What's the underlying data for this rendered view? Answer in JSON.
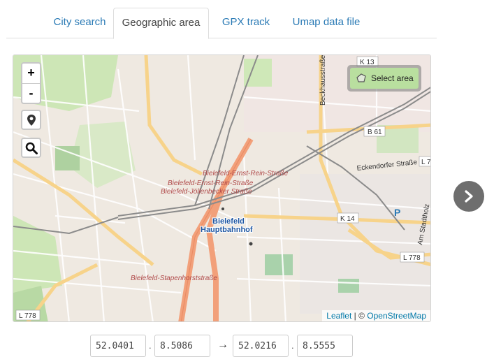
{
  "tabs": [
    {
      "label": "City search",
      "active": false
    },
    {
      "label": "Geographic area",
      "active": true
    },
    {
      "label": "GPX track",
      "active": false
    },
    {
      "label": "Umap data file",
      "active": false
    }
  ],
  "map": {
    "zoom_in_label": "+",
    "zoom_out_label": "-",
    "locate_icon": "map-marker-icon",
    "search_icon": "search-icon",
    "select_area_label": "Select area",
    "attribution": {
      "leaflet": "Leaflet",
      "separator": " | © ",
      "osm": "OpenStreetMap"
    },
    "labels": {
      "k13": "K 13",
      "beckhausstrasse": "Beckhausstraße",
      "b61": "B 61",
      "eckendorfer": "Eckendorfer Straße",
      "l7": "L 7",
      "k14": "K 14",
      "amstadtholz": "Am Stadtholz",
      "l778a": "L 778",
      "l778b": "L 778",
      "parking": "P",
      "station1": "Bielefeld-Ernst-Rein-Straße",
      "station2": "Bielefeld-Ernst-Rein-Straße",
      "station3": "Bielefeld-Jöllenbecker Straße",
      "hbf1": "Bielefeld",
      "hbf2": "Hauptbahnhof",
      "station4": "Bielefeld-Stapenhorststraße"
    },
    "colors": {
      "background": "#efe9e1",
      "railway": "#8a8a8a",
      "major_road": "#f3a77d",
      "secondary_road": "#fbd98e",
      "park": "#c8e3b0"
    }
  },
  "coordinates": {
    "lat1": "52.0401",
    "lon1": "8.5086",
    "lat2": "52.0216",
    "lon2": "8.5555",
    "separator": ".",
    "arrow": "→"
  },
  "next_button_icon": "chevron-right-icon"
}
